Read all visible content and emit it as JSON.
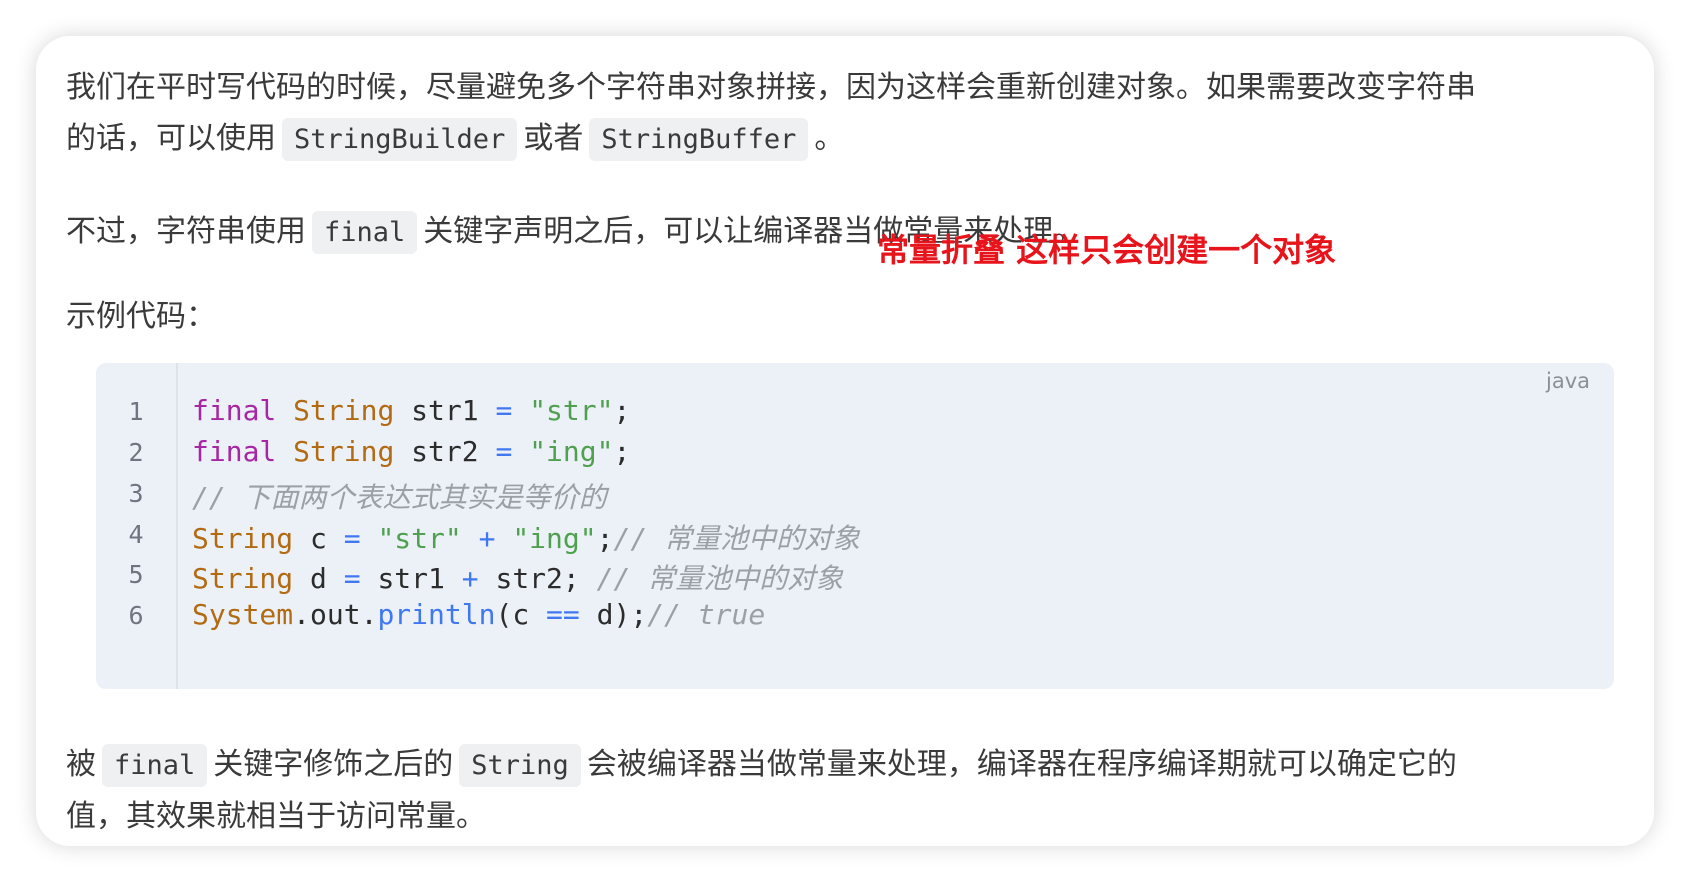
{
  "paragraph1": {
    "text_a": "我们在平时写代码的时候，尽量避免多个字符串对象拼接，因为这样会重新创建对象。如果需要改变字符串",
    "text_b": "的话，可以使用",
    "code_a": "StringBuilder",
    "text_c": "或者",
    "code_b": "StringBuffer",
    "text_d": "。"
  },
  "paragraph2": {
    "text_a": "不过，字符串使用",
    "code_a": "final",
    "text_b": "关键字声明之后，可以让编译器当做常量来处理。"
  },
  "annotation": "常量折叠 这样只会创建一个对象",
  "paragraph3": {
    "text": "示例代码："
  },
  "code_block": {
    "language": "java",
    "line_numbers": [
      "1",
      "2",
      "3",
      "4",
      "5",
      "6"
    ],
    "lines": [
      {
        "kw": "final",
        "type": "String",
        "id": " str1 ",
        "op": "=",
        "str": "\"str\"",
        "punc": ";"
      },
      {
        "kw": "final",
        "type": "String",
        "id": " str2 ",
        "op": "=",
        "str": "\"ing\"",
        "punc": ";"
      },
      {
        "comment": "// 下面两个表达式其实是等价的"
      },
      {
        "type": "String",
        "id": " c ",
        "op1": "=",
        "str1": "\"str\"",
        "op2": "+",
        "str2": "\"ing\"",
        "punc": ";",
        "comment": "// 常量池中的对象"
      },
      {
        "type": "String",
        "id1": " d ",
        "op1": "=",
        "id2": " str1 ",
        "op2": "+",
        "id3": " str2; ",
        "comment": "// 常量池中的对象"
      },
      {
        "type": "System",
        "id1": ".out.",
        "fn": "println",
        "id2": "(c ",
        "op": "==",
        "id3": " d);",
        "comment": "// true"
      }
    ]
  },
  "paragraph4": {
    "text_a": "被",
    "code_a": "final",
    "text_b": "关键字修饰之后的",
    "code_b": "String",
    "text_c": "会被编译器当做常量来处理，编译器在程序编译期就可以确定它的",
    "text_d": "值，其效果就相当于访问常量。"
  },
  "colors": {
    "keyword": "#a626a4",
    "type": "#b26b12",
    "string": "#50a14f",
    "operator": "#4078f2",
    "comment": "#9aa0a6",
    "annotation": "#e8141b",
    "code_background": "#ecf1f8"
  }
}
